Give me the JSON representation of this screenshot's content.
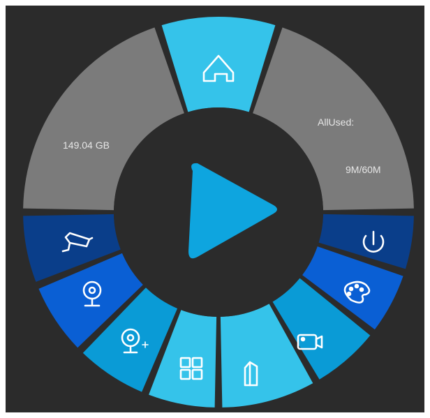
{
  "storage": {
    "capacity_text": "149.04 GB",
    "used_label": "AllUsed:",
    "used_value": "9M/60M"
  },
  "colors": {
    "background": "#2b2b2b",
    "storage_gray": "#7b7b7b",
    "light_cyan": "#35c3ea",
    "mid_blue": "#0a9bd6",
    "bright_blue": "#0a5fd4",
    "dark_navy": "#0a3e8a",
    "play": "#0ea5df"
  },
  "icons": {
    "home": "home-icon",
    "play": "play-icon",
    "cctv": "cctv-camera-icon",
    "webcam": "webcam-icon",
    "webcam_add": "webcam-add-icon",
    "grid": "grid-icon",
    "door": "door-icon",
    "video": "video-camera-icon",
    "palette": "palette-icon",
    "power": "power-icon"
  }
}
